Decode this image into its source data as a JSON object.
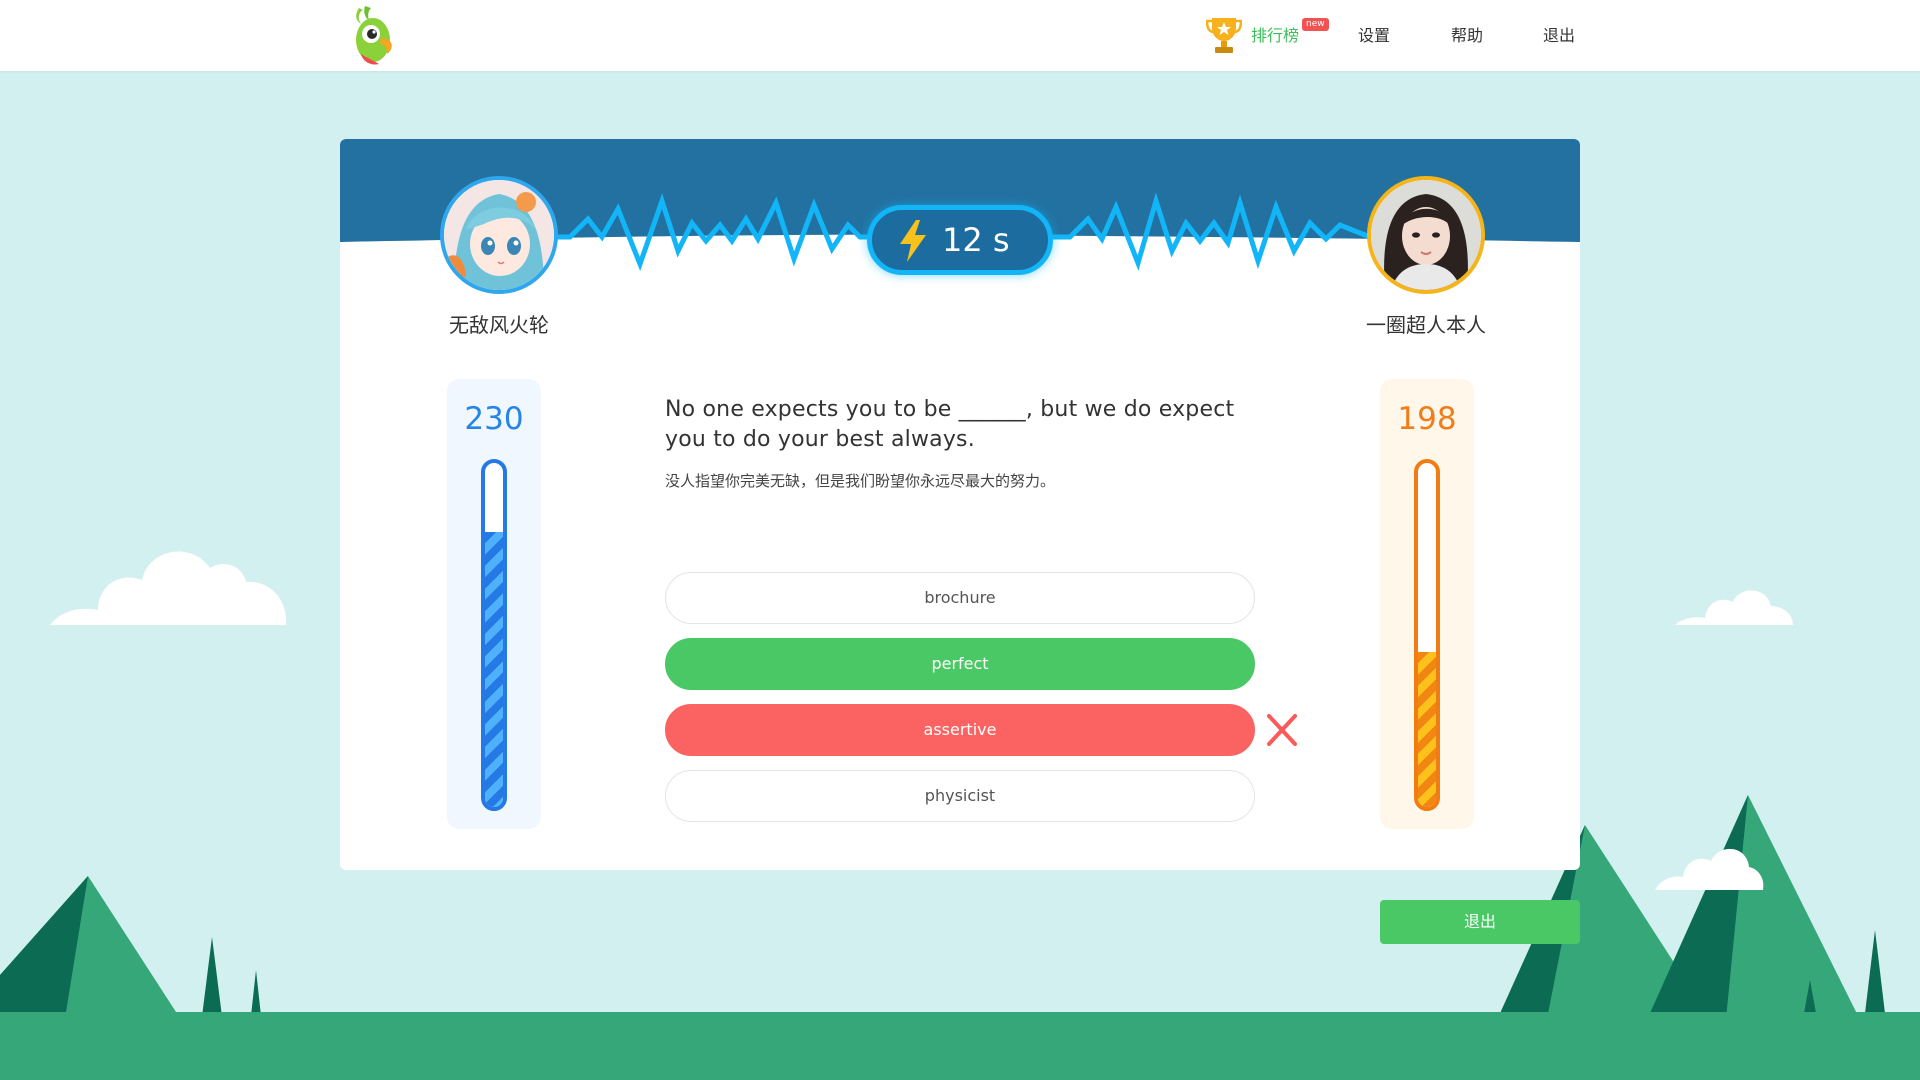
{
  "nav": {
    "logo_icon": "parrot-logo-icon",
    "rank_label": "排行榜",
    "rank_badge": "new",
    "settings_label": "设置",
    "help_label": "帮助",
    "logout_label": "退出"
  },
  "battle": {
    "timer_text": "12 s",
    "player_left": {
      "name": "无敌风火轮",
      "score": "230",
      "progress": 0.8,
      "color": "#2479e4"
    },
    "player_right": {
      "name": "一圈超人本人",
      "score": "198",
      "progress": 0.45,
      "color": "#f17d12"
    }
  },
  "question": {
    "text": "No one expects you to be ______, but we do expect you to do your best always.",
    "translation": "没人指望你完美无缺，但是我们盼望你永远尽最大的努力。",
    "options": [
      {
        "label": "brochure",
        "state": "default"
      },
      {
        "label": "perfect",
        "state": "correct"
      },
      {
        "label": "assertive",
        "state": "wrong"
      },
      {
        "label": "physicist",
        "state": "default"
      }
    ]
  },
  "footer": {
    "exit_label": "退出"
  },
  "colors": {
    "correct": "#49c865",
    "wrong": "#fb6262",
    "header_blue": "#2371a0",
    "wave": "#12b6f8"
  }
}
